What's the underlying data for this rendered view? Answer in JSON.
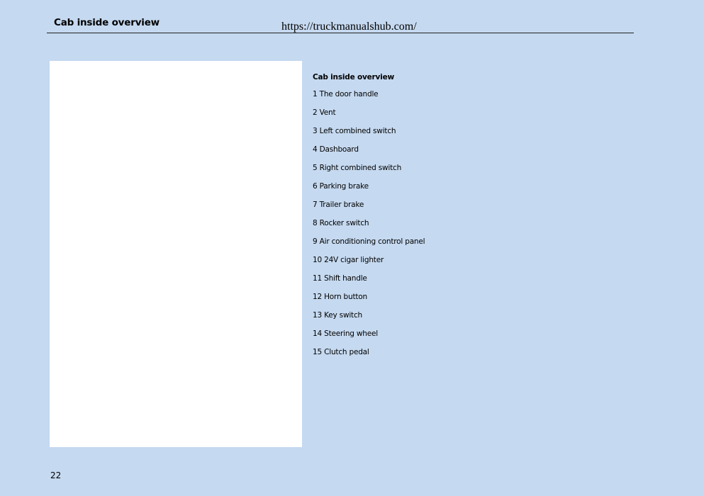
{
  "header": {
    "title": "Cab inside overview",
    "url": "https://truckmanualshub.com/"
  },
  "legend": {
    "title": "Cab inside overview",
    "items": [
      "1 The door handle",
      "2 Vent",
      "3 Left combined switch",
      "4 Dashboard",
      "5 Right combined switch",
      "6 Parking brake",
      "7 Trailer brake",
      "8 Rocker switch",
      "9 Air conditioning control panel",
      "10 24V cigar lighter",
      "11 Shift handle",
      "12 Horn button",
      "13 Key switch",
      "14 Steering wheel",
      "15 Clutch pedal"
    ]
  },
  "footer": {
    "page_number": "22"
  }
}
